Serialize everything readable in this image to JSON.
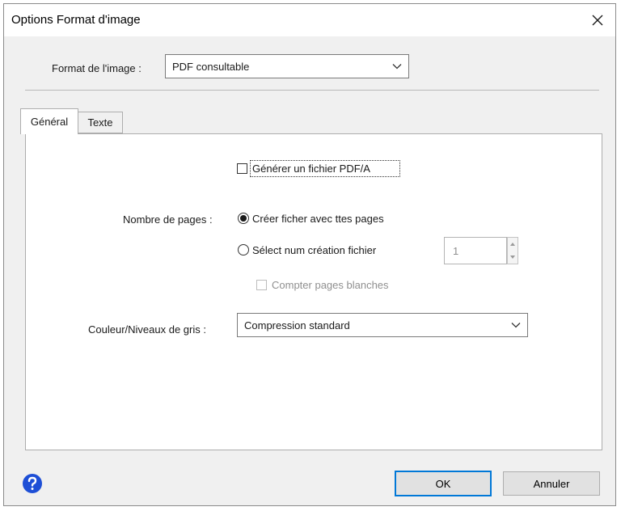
{
  "window": {
    "title": "Options Format d'image"
  },
  "format": {
    "label": "Format de l'image :",
    "value": "PDF consultable"
  },
  "tabs": [
    {
      "label": "Général",
      "active": true
    },
    {
      "label": "Texte",
      "active": false
    }
  ],
  "general": {
    "pdfa_checkbox": {
      "label": "Générer un fichier PDF/A",
      "checked": false
    },
    "pages_label": "Nombre de pages :",
    "radio_all": {
      "label": "Créer ficher avec ttes pages",
      "checked": true
    },
    "radio_select": {
      "label": "Sélect num création fichier",
      "checked": false
    },
    "page_count_value": "1",
    "blank_pages_checkbox": {
      "label": "Compter pages blanches",
      "checked": false,
      "disabled": true
    },
    "color_label": "Couleur/Niveaux de gris :",
    "color_value": "Compression standard"
  },
  "footer": {
    "ok_label": "OK",
    "cancel_label": "Annuler"
  },
  "colors": {
    "accent": "#0078d7",
    "help_blue": "#1e4fd6"
  },
  "icons": {
    "close": "close-icon",
    "chevron": "chevron-down-icon",
    "help": "help-icon"
  }
}
